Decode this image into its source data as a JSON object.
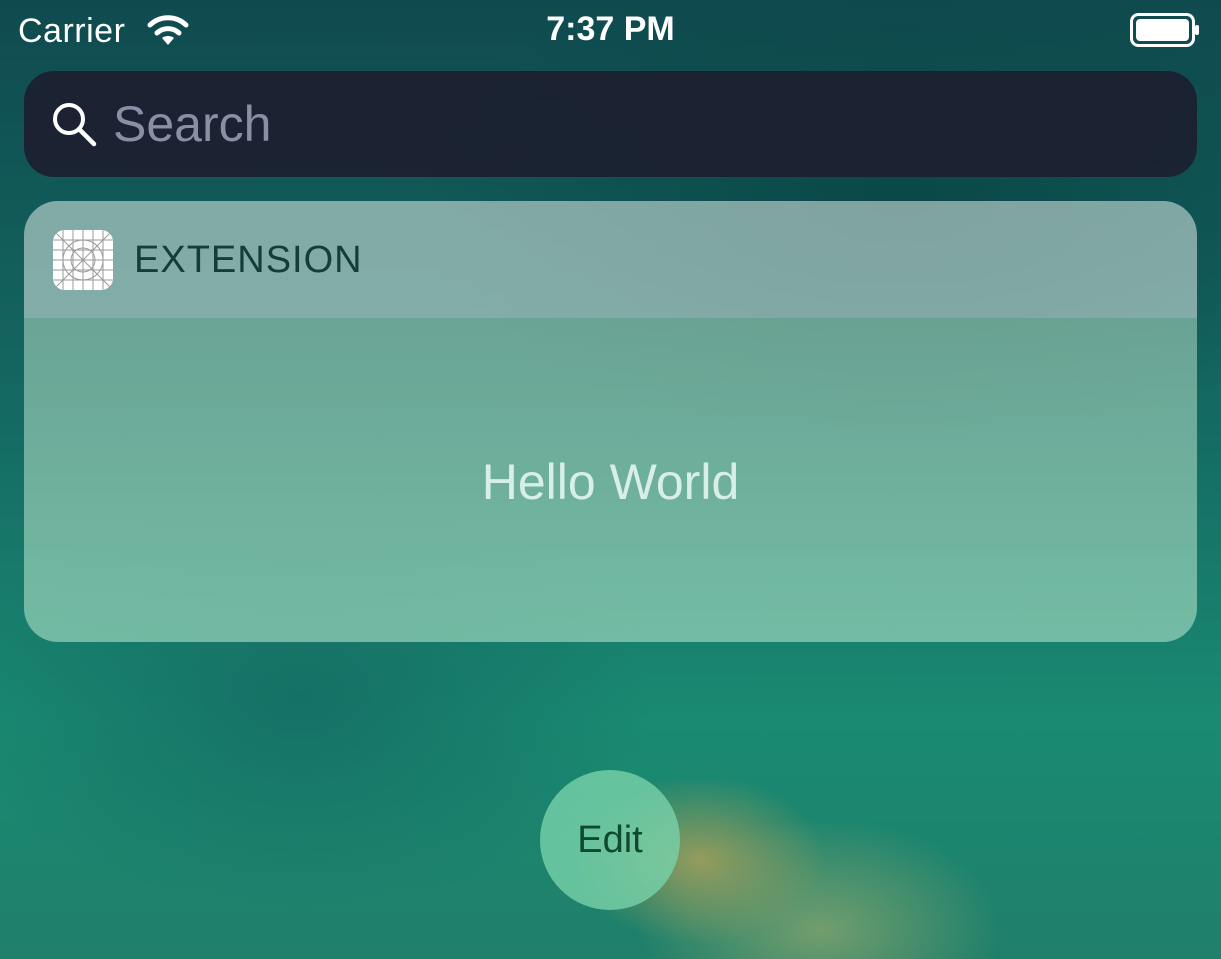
{
  "status_bar": {
    "carrier": "Carrier",
    "time": "7:37 PM",
    "wifi_icon": "wifi-icon",
    "battery_icon": "battery-icon"
  },
  "search": {
    "placeholder": "Search",
    "icon": "search-icon"
  },
  "widget": {
    "app_icon": "app-placeholder-icon",
    "title": "EXTENSION",
    "body_text": "Hello World"
  },
  "edit_button": {
    "label": "Edit"
  },
  "colors": {
    "widget_title": "#123d38",
    "hello_text": "#d8efe8",
    "edit_text": "#0f4a2e"
  }
}
